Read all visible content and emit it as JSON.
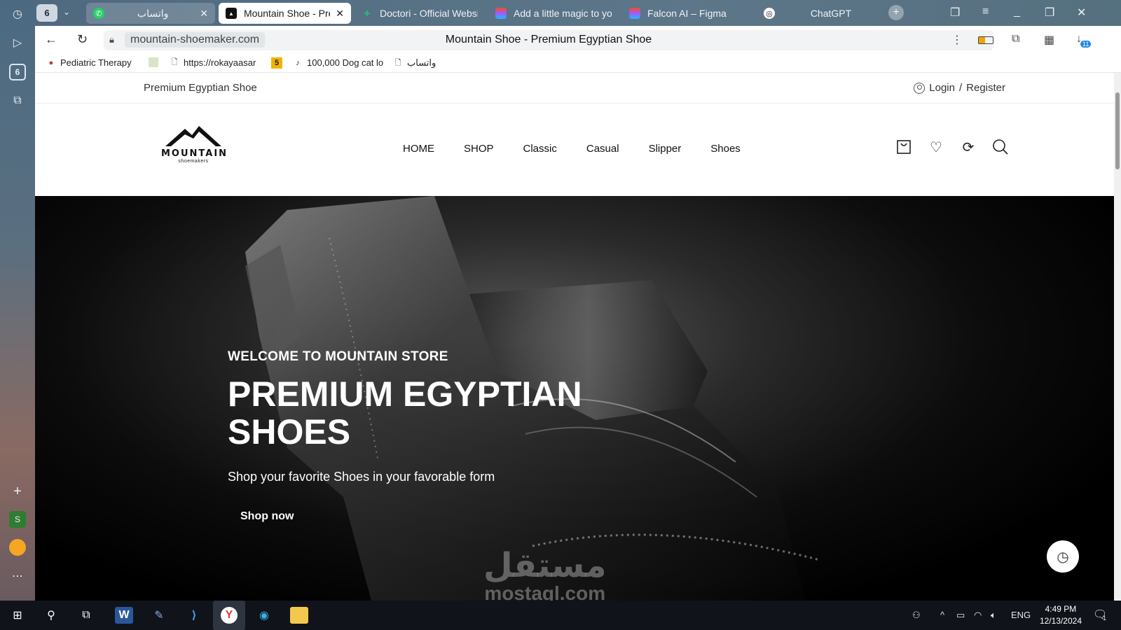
{
  "browser": {
    "sidebar": {
      "tab_count_badge": "6"
    },
    "tabs_badge": "6",
    "tabs": [
      {
        "label": "واتساب",
        "icon": "whatsapp-icon",
        "color": "#25d366",
        "active": false
      },
      {
        "label": "Mountain Shoe - Premium Egyptian Shoe",
        "icon": "mountain-favicon",
        "active": true
      },
      {
        "label": "Doctori - Official Website",
        "icon": "doctori-favicon",
        "color": "#2bb673",
        "active": false
      },
      {
        "label": "Add a little magic to your",
        "icon": "figma-icon",
        "active": false
      },
      {
        "label": "Falcon AI – Figma",
        "icon": "figma-icon",
        "active": false
      },
      {
        "label": "ChatGPT",
        "icon": "chatgpt-icon",
        "active": false
      }
    ],
    "address": {
      "url": "mountain-shoemaker.com",
      "page_title": "Mountain Shoe - Premium Egyptian Shoe"
    },
    "download_badge": "11",
    "bookmarks": [
      {
        "label": "Pediatric Therapy",
        "icon": "pediatric-favicon"
      },
      {
        "label": "",
        "icon": "image-favicon"
      },
      {
        "label": "https://rokayaasar",
        "icon": "page-icon"
      },
      {
        "label": "5",
        "icon": "five-favicon"
      },
      {
        "label": "100,000 Dog cat lo",
        "icon": "tiktok-icon"
      },
      {
        "label": "واتساب",
        "icon": "page-icon"
      }
    ]
  },
  "site": {
    "topbar": {
      "tagline": "Premium Egyptian Shoe",
      "login": "Login",
      "separator": "/",
      "register": "Register"
    },
    "logo": {
      "name": "MOUNTAIN",
      "sub": "shoemakers"
    },
    "menu": [
      "HOME",
      "SHOP",
      "Classic",
      "Casual",
      "Slipper",
      "Shoes"
    ],
    "hero": {
      "welcome": "WELCOME TO MOUNTAIN STORE",
      "headline": "PREMIUM EGYPTIAN SHOES",
      "subtitle": "Shop your favorite Shoes in your favorable form",
      "cta": "Shop now"
    }
  },
  "watermark": {
    "arabic": "مستقل",
    "latin": "mostaql.com"
  },
  "taskbar": {
    "language": "ENG",
    "time": "4:49 PM",
    "date": "12/13/2024",
    "notification_badge": "1"
  }
}
